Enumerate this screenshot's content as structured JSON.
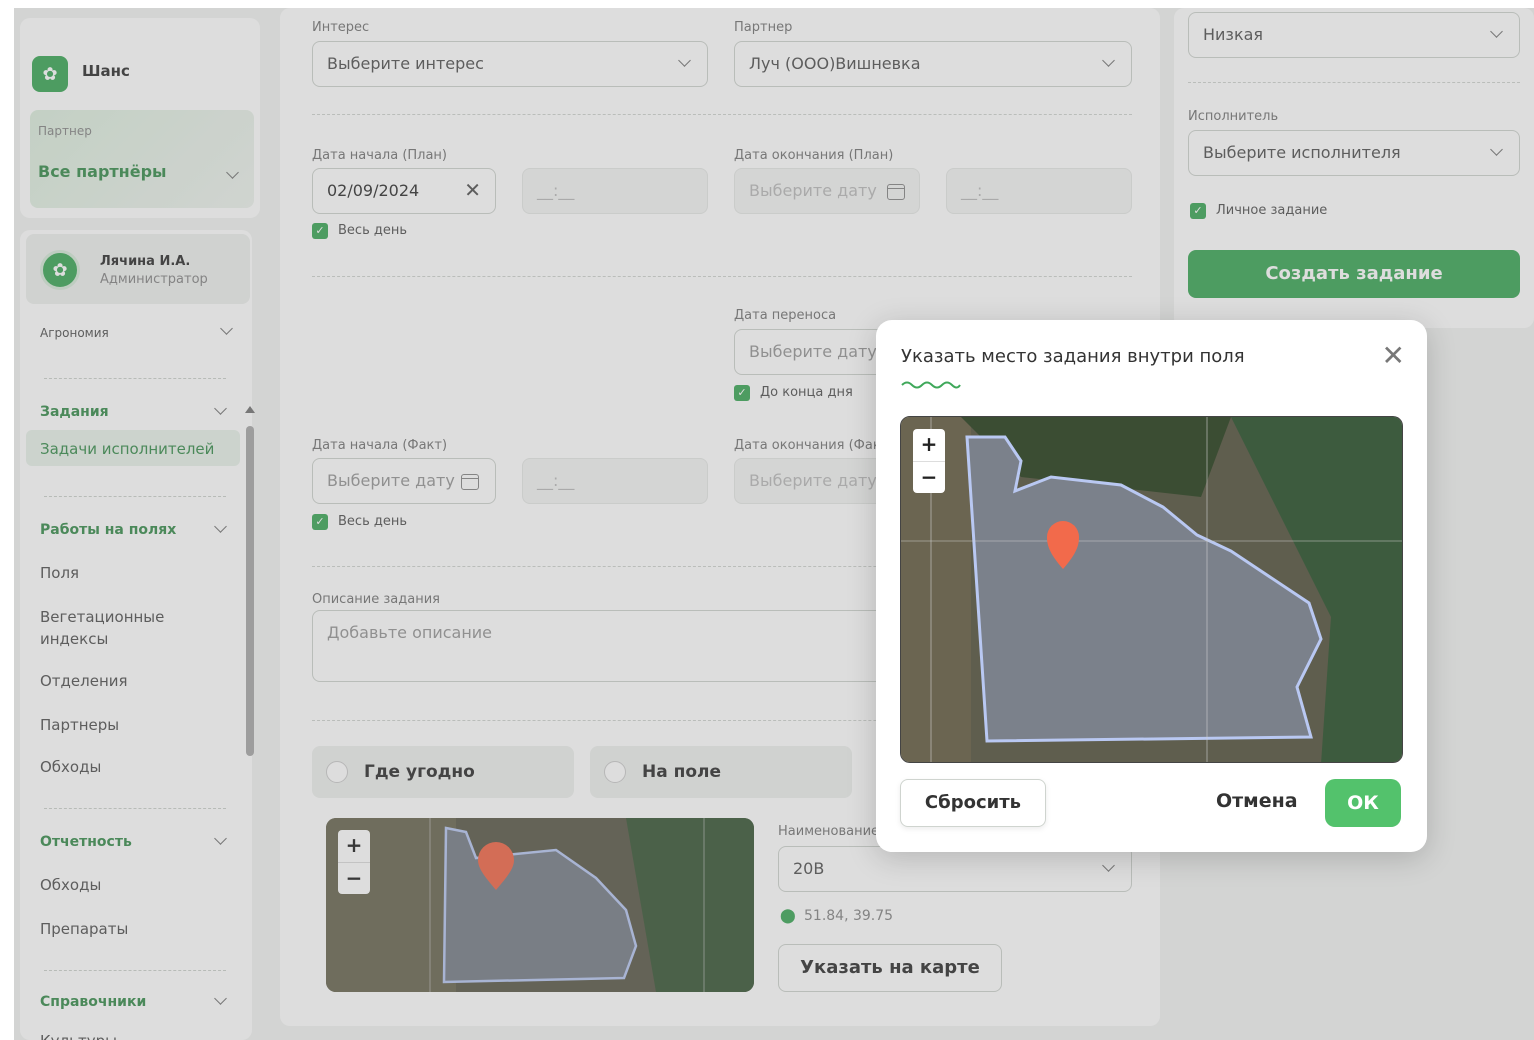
{
  "colors": {
    "accent": "#3fa85a",
    "accent_text": "#3c8f50",
    "pin": "#f26a4b",
    "field_outline": "#9ab4f0"
  },
  "sidebar": {
    "brand": "Шанс",
    "partner_label": "Партнер",
    "partner_value": "Все партнёры",
    "user_name": "Лячина И.А.",
    "user_role": "Администратор",
    "section_agronomy": "Агрономия",
    "tasks_head": "Задания",
    "tasks_items": [
      "Задачи исполнителей"
    ],
    "field_work_head": "Работы на полях",
    "field_work_items": [
      "Поля",
      "Вегетационные индексы",
      "Отделения",
      "Партнеры",
      "Обходы"
    ],
    "reports_head": "Отчетность",
    "reports_items": [
      "Обходы",
      "Препараты"
    ],
    "references_head": "Справочники",
    "references_items": [
      "Культуры"
    ]
  },
  "form": {
    "interest_label": "Интерес",
    "interest_placeholder": "Выберите интерес",
    "partner_label": "Партнер",
    "partner_value": "Луч (ООО)Вишневка",
    "start_plan_label": "Дата начала (План)",
    "start_plan_value": "02/09/2024",
    "time_placeholder": "__:__",
    "end_plan_label": "Дата окончания (План)",
    "date_placeholder": "Выберите дату",
    "all_day": "Весь день",
    "transfer_label": "Дата переноса",
    "until_end_of_day": "До конца дня",
    "start_fact_label": "Дата начала (Факт)",
    "end_fact_label": "Дата окончания (Факт)",
    "description_label": "Описание задания",
    "description_placeholder": "Добавьте описание",
    "location_anywhere": "Где угодно",
    "location_field": "На поле",
    "field_name_label": "Наименование поля",
    "field_name_value": "20В",
    "coordinates": "51.84, 39.75",
    "show_on_map": "Указать на карте",
    "zoom_in": "+",
    "zoom_out": "−"
  },
  "right_panel": {
    "priority_value": "Низкая",
    "executor_label": "Исполнитель",
    "executor_placeholder": "Выберите исполнителя",
    "personal_task": "Личное задание",
    "create_button": "Создать задание"
  },
  "modal": {
    "title": "Указать место задания внутри поля",
    "reset": "Сбросить",
    "cancel": "Отмена",
    "ok": "ОК",
    "zoom_in": "+",
    "zoom_out": "−"
  }
}
